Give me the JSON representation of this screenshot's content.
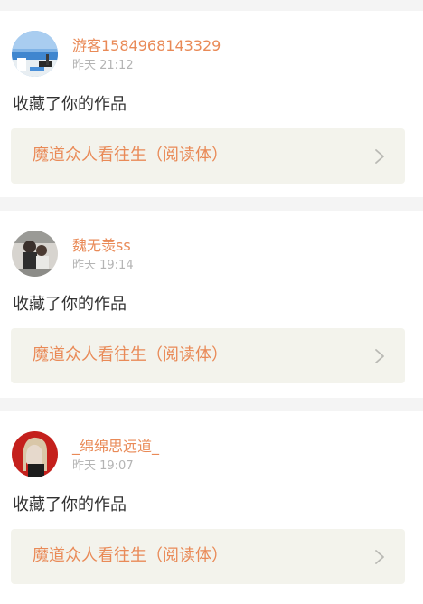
{
  "notifications": [
    {
      "username": "游客1584968143329",
      "time": "昨天 21:12",
      "action": "收藏了你的作品",
      "work_title": "魔道众人看往生（阅读体）",
      "avatar_icon": "seaside-photo-avatar"
    },
    {
      "username": "魏无羡ss",
      "time": "昨天 19:14",
      "action": "收藏了你的作品",
      "work_title": "魔道众人看往生（阅读体）",
      "avatar_icon": "couple-photo-avatar"
    },
    {
      "username": "_绵绵思远道_",
      "time": "昨天 19:07",
      "action": "收藏了你的作品",
      "work_title": "魔道众人看往生（阅读体）",
      "avatar_icon": "portrait-photo-avatar"
    }
  ],
  "colors": {
    "accent": "#e98a57",
    "background": "#f4f4f4",
    "card": "#ffffff",
    "link_bg": "#f3f3ec",
    "time_text": "#b4b4b4",
    "body_text": "#333333"
  }
}
